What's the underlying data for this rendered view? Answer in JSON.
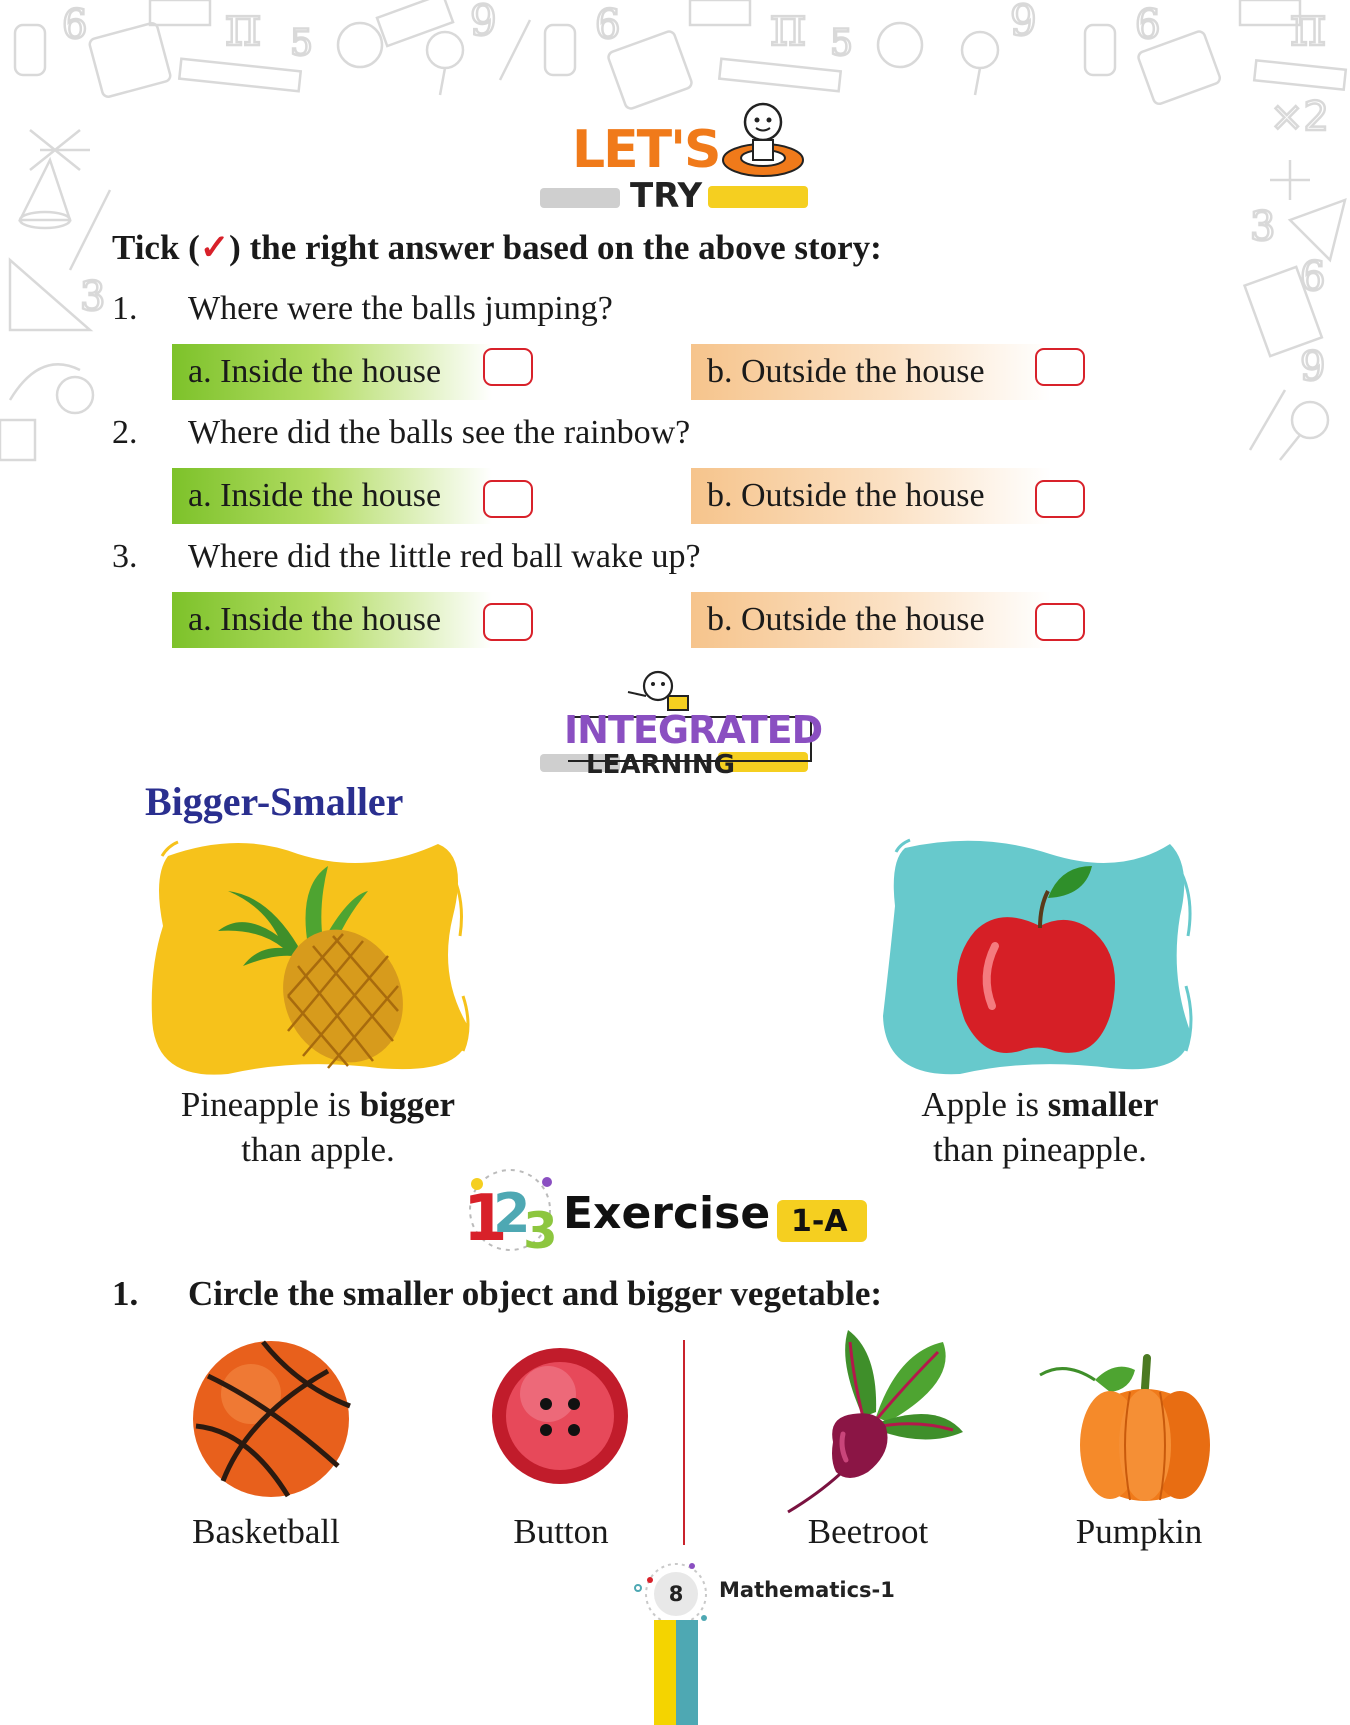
{
  "header": {
    "lets_try_line1": "LET'S",
    "lets_try_line2": "TRY",
    "instruction_prefix": "Tick (",
    "tick_glyph": "✓",
    "instruction_suffix": ") the right answer based on the above story:"
  },
  "questions": [
    {
      "number": "1.",
      "text": "Where were the balls jumping?",
      "option_a": "a. Inside the house",
      "option_b": "b. Outside the house"
    },
    {
      "number": "2.",
      "text": "Where did the balls see the rainbow?",
      "option_a": "a. Inside the house",
      "option_b": "b. Outside the house"
    },
    {
      "number": "3.",
      "text": "Where did the little red ball wake up?",
      "option_a": "a. Inside the house",
      "option_b": "b. Outside the house"
    }
  ],
  "integrated": {
    "line1": "INTEGRATED",
    "line2": "LEARNING"
  },
  "comparison": {
    "title": "Bigger-Smaller",
    "left_caption_pre": "Pineapple is ",
    "left_caption_bold": "bigger",
    "left_caption_line2": "than apple.",
    "right_caption_pre": "Apple is ",
    "right_caption_bold": "smaller",
    "right_caption_line2": "than pineapple."
  },
  "exercise": {
    "label": "Exercise",
    "badge": "1-A",
    "number": "1.",
    "instruction": "Circle the smaller object and bigger vegetable:",
    "items": [
      {
        "label": "Basketball",
        "icon": "basketball-icon"
      },
      {
        "label": "Button",
        "icon": "button-icon"
      },
      {
        "label": "Beetroot",
        "icon": "beetroot-icon"
      },
      {
        "label": "Pumpkin",
        "icon": "pumpkin-icon"
      }
    ]
  },
  "footer": {
    "page_number": "8",
    "book_title": "Mathematics-1"
  },
  "colors": {
    "accent_red": "#d8212a",
    "title_blue": "#2a2f8f",
    "lets_orange": "#f07a1a",
    "integrated_purple": "#8a4fc1",
    "blob_yellow": "#f6c21b",
    "blob_teal": "#67c9cc",
    "option_green": "#7dc22a",
    "option_peach": "#f6c48c"
  }
}
